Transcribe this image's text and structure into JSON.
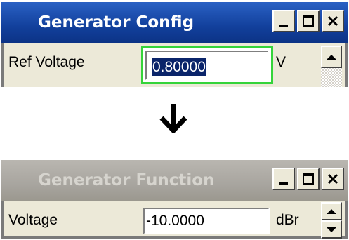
{
  "window_top": {
    "title": "Generator Config",
    "field_label": "Ref Voltage",
    "field_value": "0.80000",
    "unit": "V"
  },
  "transition": {
    "icon": "down-arrow-icon"
  },
  "window_bottom": {
    "title": "Generator Function",
    "field_label": "Voltage",
    "field_value": "-10.0000",
    "unit": "dBr"
  },
  "colors": {
    "active_title": "#12409c",
    "inactive_title": "#a8a59f",
    "focus_border": "#35d43a",
    "selection": "#0a246a"
  }
}
